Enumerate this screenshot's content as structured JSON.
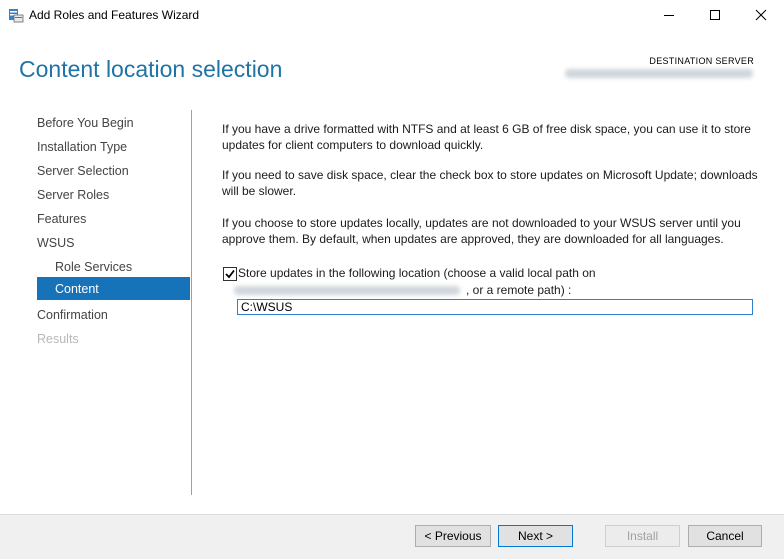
{
  "window": {
    "title": "Add Roles and Features Wizard",
    "icons": [
      "server-manager-icon",
      "minimize-icon",
      "maximize-icon",
      "close-icon"
    ]
  },
  "header": {
    "page_title": "Content location selection",
    "destination_label": "DESTINATION SERVER"
  },
  "nav": {
    "items": [
      {
        "label": "Before You Begin",
        "state": "normal"
      },
      {
        "label": "Installation Type",
        "state": "normal"
      },
      {
        "label": "Server Selection",
        "state": "normal"
      },
      {
        "label": "Server Roles",
        "state": "normal"
      },
      {
        "label": "Features",
        "state": "normal"
      },
      {
        "label": "WSUS",
        "state": "normal"
      },
      {
        "label": "Role Services",
        "state": "normal"
      },
      {
        "label": "Content",
        "state": "selected"
      },
      {
        "label": "Confirmation",
        "state": "normal"
      },
      {
        "label": "Results",
        "state": "disabled"
      }
    ]
  },
  "main": {
    "paragraph1": "If you have a drive formatted with NTFS and at least 6 GB of free disk space, you can use it to store updates for client computers to download quickly.",
    "paragraph2": "If you need to save disk space, clear the check box to store updates on Microsoft Update; downloads will be slower.",
    "paragraph3": "If you choose to store updates locally, updates are not downloaded to your WSUS server until you approve them. By default, when updates are approved, they are downloaded for all languages.",
    "checkbox_label": "Store updates in the following location (choose a valid local path on",
    "checkbox_checked": true,
    "remote_path_label": ", or a remote path) :",
    "path_value": "C:\\WSUS"
  },
  "footer": {
    "previous": "< Previous",
    "next": "Next >",
    "install": "Install",
    "cancel": "Cancel"
  },
  "colors": {
    "title_blue": "#1e73a7",
    "selection_blue": "#1672b9",
    "input_border": "#2f7fcf"
  }
}
